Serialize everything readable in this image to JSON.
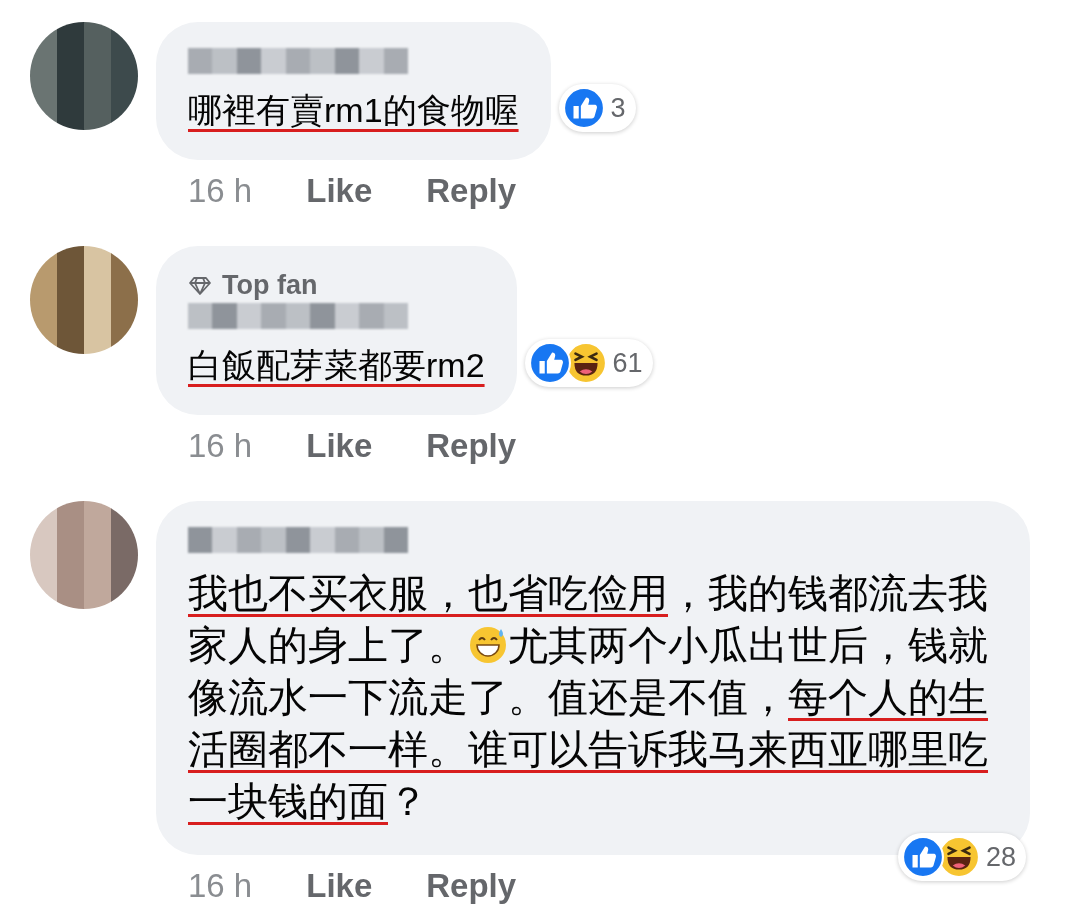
{
  "comments": [
    {
      "segments": [
        {
          "kind": "text",
          "text": "哪裡有賣rm1的食物喔",
          "underlined": true
        }
      ],
      "reactions": {
        "icons": [
          {
            "kind": "like"
          }
        ],
        "count": "3",
        "kind": "side"
      },
      "actions": {
        "time": "16 h",
        "like": "Like",
        "reply": "Reply"
      }
    },
    {
      "badge": "Top fan",
      "segments": [
        {
          "kind": "text",
          "text": "白飯配芽菜都要rm2",
          "underlined": true
        }
      ],
      "reactions": {
        "icons": [
          {
            "kind": "like"
          },
          {
            "kind": "haha"
          }
        ],
        "count": "61",
        "kind": "side"
      },
      "actions": {
        "time": "16 h",
        "like": "Like",
        "reply": "Reply"
      }
    },
    {
      "segments": [
        {
          "kind": "text",
          "text": "我也不买衣服，也省吃俭用",
          "underlined": true
        },
        {
          "kind": "text",
          "text": "，我的钱都流去我家人的身上了。",
          "underlined": false
        },
        {
          "kind": "emoji"
        },
        {
          "kind": "text",
          "text": "尤其两个小瓜出世后，钱就像流水一下流走了。值还是不值，",
          "underlined": false
        },
        {
          "kind": "text",
          "text": "每个人的生活圈都不一样。谁可以告诉我马来西亚哪里吃一块钱的面",
          "underlined": true
        },
        {
          "kind": "text",
          "text": "？",
          "underlined": false
        }
      ],
      "reactions": {
        "icons": [
          {
            "kind": "like"
          },
          {
            "kind": "haha"
          }
        ],
        "count": "28",
        "kind": "bottom"
      },
      "actions": {
        "time": "16 h",
        "like": "Like",
        "reply": "Reply"
      }
    }
  ]
}
